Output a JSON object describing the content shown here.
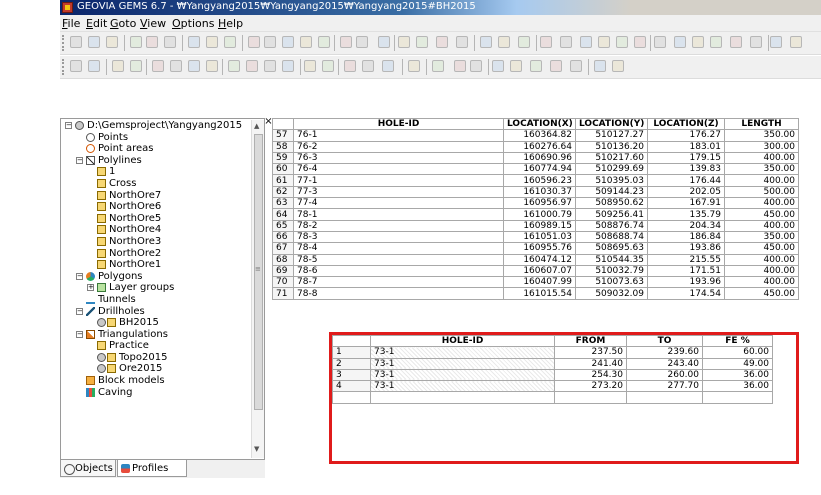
{
  "window": {
    "title": "GEOVIA GEMS 6.7 - ₩Yangyang2015₩Yangyang2015₩Yangyang2015#BH2015"
  },
  "menu": [
    {
      "pre": "",
      "u": "F",
      "post": "ile"
    },
    {
      "pre": "",
      "u": "E",
      "post": "dit"
    },
    {
      "pre": "",
      "u": "G",
      "post": "oto"
    },
    {
      "pre": "",
      "u": "V",
      "post": "iew"
    },
    {
      "pre": "",
      "u": "O",
      "post": "ptions"
    },
    {
      "pre": "",
      "u": "H",
      "post": "elp"
    }
  ],
  "panel": {
    "close_label": "×",
    "tree": [
      {
        "label": "D:\\Gemsproject\\Yangyang2015",
        "level": 0,
        "expander": "-",
        "icon": "eye-icon"
      },
      {
        "label": "Points",
        "level": 1,
        "expander": "",
        "icon": "points-icon"
      },
      {
        "label": "Point areas",
        "level": 1,
        "expander": "",
        "icon": "point-areas-icon"
      },
      {
        "label": "Polylines",
        "level": 1,
        "expander": "-",
        "icon": "polylines-icon"
      },
      {
        "label": "1",
        "level": 2,
        "expander": "",
        "icon": "line-layer-icon"
      },
      {
        "label": "Cross",
        "level": 2,
        "expander": "",
        "icon": "line-layer-icon"
      },
      {
        "label": "NorthOre7",
        "level": 2,
        "expander": "",
        "icon": "line-layer-icon"
      },
      {
        "label": "NorthOre6",
        "level": 2,
        "expander": "",
        "icon": "line-layer-icon"
      },
      {
        "label": "NorthOre5",
        "level": 2,
        "expander": "",
        "icon": "line-layer-icon"
      },
      {
        "label": "NorthOre4",
        "level": 2,
        "expander": "",
        "icon": "line-layer-icon"
      },
      {
        "label": "NorthOre3",
        "level": 2,
        "expander": "",
        "icon": "line-layer-icon"
      },
      {
        "label": "NorthOre2",
        "level": 2,
        "expander": "",
        "icon": "line-layer-icon"
      },
      {
        "label": "NorthOre1",
        "level": 2,
        "expander": "",
        "icon": "line-layer-icon"
      },
      {
        "label": "Polygons",
        "level": 1,
        "expander": "-",
        "icon": "polygons-icon"
      },
      {
        "label": "Layer groups",
        "level": 2,
        "expander": "+",
        "icon": "layer-groups-icon"
      },
      {
        "label": "Tunnels",
        "level": 1,
        "expander": "",
        "icon": "tunnels-icon"
      },
      {
        "label": "Drillholes",
        "level": 1,
        "expander": "-",
        "icon": "drillholes-icon"
      },
      {
        "label": "BH2015",
        "level": 2,
        "expander": "",
        "icon": "drillhole-set-icon"
      },
      {
        "label": "Triangulations",
        "level": 1,
        "expander": "-",
        "icon": "triangulations-icon"
      },
      {
        "label": "Practice",
        "level": 2,
        "expander": "",
        "icon": "triangulation-layer-icon"
      },
      {
        "label": "Topo2015",
        "level": 2,
        "expander": "",
        "icon": "triangulation-visible-icon"
      },
      {
        "label": "Ore2015",
        "level": 2,
        "expander": "",
        "icon": "triangulation-visible-icon"
      },
      {
        "label": "Block models",
        "level": 1,
        "expander": "",
        "icon": "block-models-icon"
      },
      {
        "label": "Caving",
        "level": 1,
        "expander": "",
        "icon": "caving-icon"
      }
    ]
  },
  "tabs": [
    {
      "label": "Objects",
      "icon": "objects-icon"
    },
    {
      "label": "Profiles",
      "icon": "profiles-icon"
    }
  ],
  "collar_table": {
    "headers": [
      "",
      "HOLE-ID",
      "LOCATION(X)",
      "LOCATION(Y)",
      "LOCATION(Z)",
      "LENGTH"
    ],
    "rows": [
      [
        "57",
        "76-1",
        "160364.82",
        "510127.27",
        "176.27",
        "350.00"
      ],
      [
        "58",
        "76-2",
        "160276.64",
        "510136.20",
        "183.01",
        "300.00"
      ],
      [
        "59",
        "76-3",
        "160690.96",
        "510217.60",
        "179.15",
        "400.00"
      ],
      [
        "60",
        "76-4",
        "160774.94",
        "510299.69",
        "139.83",
        "350.00"
      ],
      [
        "61",
        "77-1",
        "160596.23",
        "510395.03",
        "176.44",
        "400.00"
      ],
      [
        "62",
        "77-3",
        "161030.37",
        "509144.23",
        "202.05",
        "500.00"
      ],
      [
        "63",
        "77-4",
        "160956.97",
        "508950.62",
        "167.91",
        "400.00"
      ],
      [
        "64",
        "78-1",
        "161000.79",
        "509256.41",
        "135.79",
        "450.00"
      ],
      [
        "65",
        "78-2",
        "160989.15",
        "508876.74",
        "204.34",
        "400.00"
      ],
      [
        "66",
        "78-3",
        "161051.03",
        "508688.74",
        "186.84",
        "350.00"
      ],
      [
        "67",
        "78-4",
        "160955.76",
        "508695.63",
        "193.86",
        "450.00"
      ],
      [
        "68",
        "78-5",
        "160474.12",
        "510544.35",
        "215.55",
        "400.00"
      ],
      [
        "69",
        "78-6",
        "160607.07",
        "510032.79",
        "171.51",
        "400.00"
      ],
      [
        "70",
        "78-7",
        "160407.99",
        "510073.63",
        "193.96",
        "400.00"
      ],
      [
        "71",
        "78-8",
        "161015.54",
        "509032.09",
        "174.54",
        "450.00"
      ]
    ]
  },
  "assay_table": {
    "headers": [
      "",
      "HOLE-ID",
      "FROM",
      "TO",
      "FE %"
    ],
    "rows": [
      [
        "1",
        "73-1",
        "237.50",
        "239.60",
        "60.00"
      ],
      [
        "2",
        "73-1",
        "241.40",
        "243.40",
        "49.00"
      ],
      [
        "3",
        "73-1",
        "254.30",
        "260.00",
        "36.00"
      ],
      [
        "4",
        "73-1",
        "273.20",
        "277.70",
        "36.00"
      ]
    ]
  },
  "colors": {
    "highlight_border": "#e01b1b",
    "title_gradient_start": "#0a246a"
  }
}
